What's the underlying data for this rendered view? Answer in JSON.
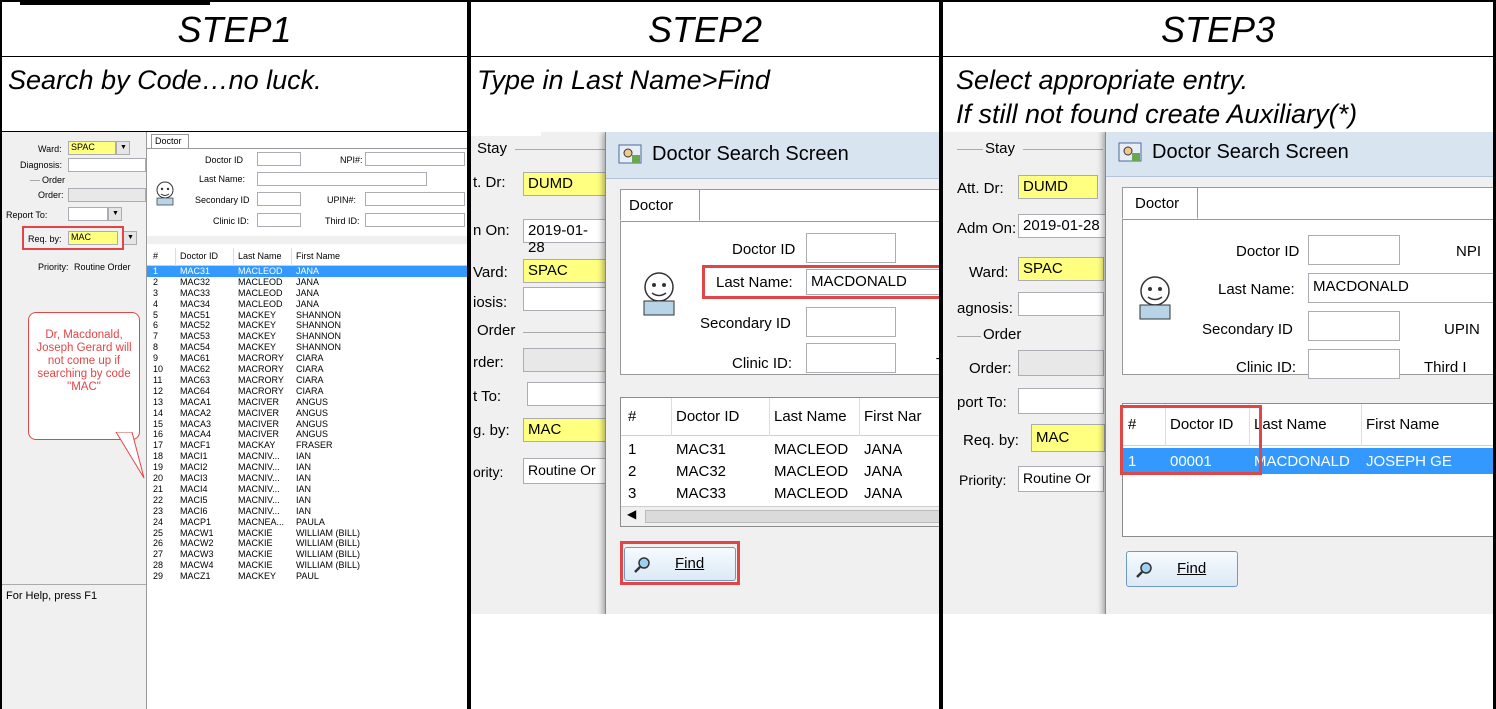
{
  "steps": [
    {
      "title": "STEP1",
      "desc1": "Search by Code…no luck.",
      "desc2": ""
    },
    {
      "title": "STEP2",
      "desc1": "Type in Last Name>Find",
      "desc2": ""
    },
    {
      "title": "STEP3",
      "desc1": "Select appropriate entry.",
      "desc2": "If still not found create Auxiliary(*)"
    }
  ],
  "s1": {
    "ward_label": "Ward:",
    "ward_value": "SPAC",
    "diagnosis_label": "Diagnosis:",
    "order_group": "Order",
    "order_label": "Order:",
    "report_label": "Report To:",
    "req_label": "Req. by:",
    "req_value": "MAC",
    "priority_label": "Priority:",
    "priority_value": "Routine Order",
    "status": "For Help, press F1",
    "callout": "Dr, Macdonald, Joseph Gerard will not come up if searching by code \"MAC\"",
    "tab": "Doctor",
    "doctor_id_label": "Doctor ID",
    "npi_label": "NPI#:",
    "last_name_label": "Last Name:",
    "secondary_label": "Secondary ID",
    "upin_label": "UPIN#:",
    "clinic_label": "Clinic ID:",
    "third_label": "Third ID:",
    "headers": [
      "#",
      "Doctor ID",
      "Last Name",
      "First Name"
    ],
    "rows": [
      [
        "1",
        "MAC31",
        "MACLEOD",
        "JANA"
      ],
      [
        "2",
        "MAC32",
        "MACLEOD",
        "JANA"
      ],
      [
        "3",
        "MAC33",
        "MACLEOD",
        "JANA"
      ],
      [
        "4",
        "MAC34",
        "MACLEOD",
        "JANA"
      ],
      [
        "5",
        "MAC51",
        "MACKEY",
        "SHANNON"
      ],
      [
        "6",
        "MAC52",
        "MACKEY",
        "SHANNON"
      ],
      [
        "7",
        "MAC53",
        "MACKEY",
        "SHANNON"
      ],
      [
        "8",
        "MAC54",
        "MACKEY",
        "SHANNON"
      ],
      [
        "9",
        "MAC61",
        "MACRORY",
        "CIARA"
      ],
      [
        "10",
        "MAC62",
        "MACRORY",
        "CIARA"
      ],
      [
        "11",
        "MAC63",
        "MACRORY",
        "CIARA"
      ],
      [
        "12",
        "MAC64",
        "MACRORY",
        "CIARA"
      ],
      [
        "13",
        "MACA1",
        "MACIVER",
        "ANGUS"
      ],
      [
        "14",
        "MACA2",
        "MACIVER",
        "ANGUS"
      ],
      [
        "15",
        "MACA3",
        "MACIVER",
        "ANGUS"
      ],
      [
        "16",
        "MACA4",
        "MACIVER",
        "ANGUS"
      ],
      [
        "17",
        "MACF1",
        "MACKAY",
        "FRASER"
      ],
      [
        "18",
        "MACI1",
        "MACNIV...",
        "IAN"
      ],
      [
        "19",
        "MACI2",
        "MACNIV...",
        "IAN"
      ],
      [
        "20",
        "MACI3",
        "MACNIV...",
        "IAN"
      ],
      [
        "21",
        "MACI4",
        "MACNIV...",
        "IAN"
      ],
      [
        "22",
        "MACI5",
        "MACNIV...",
        "IAN"
      ],
      [
        "23",
        "MACI6",
        "MACNIV...",
        "IAN"
      ],
      [
        "24",
        "MACP1",
        "MACNEA...",
        "PAULA"
      ],
      [
        "25",
        "MACW1",
        "MACKIE",
        "WILLIAM (BILL)"
      ],
      [
        "26",
        "MACW2",
        "MACKIE",
        "WILLIAM (BILL)"
      ],
      [
        "27",
        "MACW3",
        "MACKIE",
        "WILLIAM (BILL)"
      ],
      [
        "28",
        "MACW4",
        "MACKIE",
        "WILLIAM (BILL)"
      ],
      [
        "29",
        "MACZ1",
        "MACKEY",
        "PAUL"
      ]
    ]
  },
  "s2": {
    "stay": "Stay",
    "att_label": "t. Dr:",
    "att_value": "DUMD",
    "adm_label": "n On:",
    "adm_value": "2019-01-28",
    "ward_label": "Vard:",
    "ward_value": "SPAC",
    "diag_label": "iosis:",
    "order_group": "Order",
    "order_label": "rder:",
    "report_label": "t To:",
    "req_label": "g. by:",
    "req_value": "MAC",
    "priority_label": "ority:",
    "priority_value": "Routine Or",
    "title": "Doctor Search Screen",
    "tab": "Doctor",
    "doctor_id_label": "Doctor ID",
    "last_name_label": "Last Name:",
    "last_name_value": "MACDONALD",
    "secondary_label": "Secondary ID",
    "clinic_label": "Clinic ID:",
    "third_label": "T",
    "headers": [
      "#",
      "Doctor ID",
      "Last Name",
      "First Nar"
    ],
    "rows": [
      [
        "1",
        "MAC31",
        "MACLEOD",
        "JANA"
      ],
      [
        "2",
        "MAC32",
        "MACLEOD",
        "JANA"
      ],
      [
        "3",
        "MAC33",
        "MACLEOD",
        "JANA"
      ]
    ],
    "find": "Find"
  },
  "s3": {
    "stay": "Stay",
    "att_label": "Att. Dr:",
    "att_value": "DUMD",
    "adm_label": "Adm On:",
    "adm_value": "2019-01-28",
    "ward_label": "Ward:",
    "ward_value": "SPAC",
    "diag_label": "agnosis:",
    "order_group": "Order",
    "order_label": "Order:",
    "report_label": "port To:",
    "req_label": "Req. by:",
    "req_value": "MAC",
    "priority_label": "Priority:",
    "priority_value": "Routine Or",
    "title": "Doctor Search Screen",
    "tab": "Doctor",
    "doctor_id_label": "Doctor ID",
    "npi_label": "NPI",
    "last_name_label": "Last Name:",
    "last_name_value": "MACDONALD",
    "secondary_label": "Secondary ID",
    "upin_label": "UPIN",
    "clinic_label": "Clinic ID:",
    "third_label": "Third I",
    "headers": [
      "#",
      "Doctor ID",
      "Last Name",
      "First Name"
    ],
    "rows": [
      [
        "1",
        "00001",
        "MACDONALD",
        "JOSEPH GE"
      ]
    ],
    "find": "Find"
  }
}
